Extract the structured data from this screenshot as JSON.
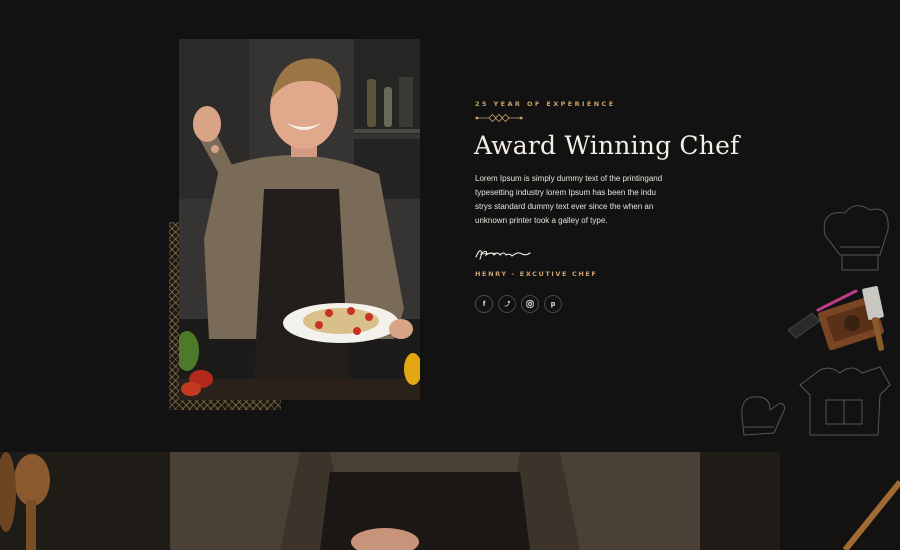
{
  "about": {
    "experience": "25 YEAR OF EXPERIENCE",
    "title": "Award Winning Chef",
    "description": "Lorem Ipsum is simply dummy text of the printingand typesetting industry lorem Ipsum has been the indu strys standard dummy text ever since the when an unknown printer took a galley of type.",
    "signature": "Henry",
    "chef_name": "HENRY - EXCUTIVE CHEF"
  },
  "social": [
    {
      "name": "facebook",
      "icon": "facebook-icon",
      "glyph": "f"
    },
    {
      "name": "twitter",
      "icon": "twitter-icon",
      "glyph": ""
    },
    {
      "name": "instagram",
      "icon": "instagram-icon",
      "glyph": ""
    },
    {
      "name": "pinterest",
      "icon": "pinterest-icon",
      "glyph": "p"
    }
  ],
  "colors": {
    "background": "#131212",
    "accent": "#c9a26a",
    "title": "#f4efe6"
  }
}
